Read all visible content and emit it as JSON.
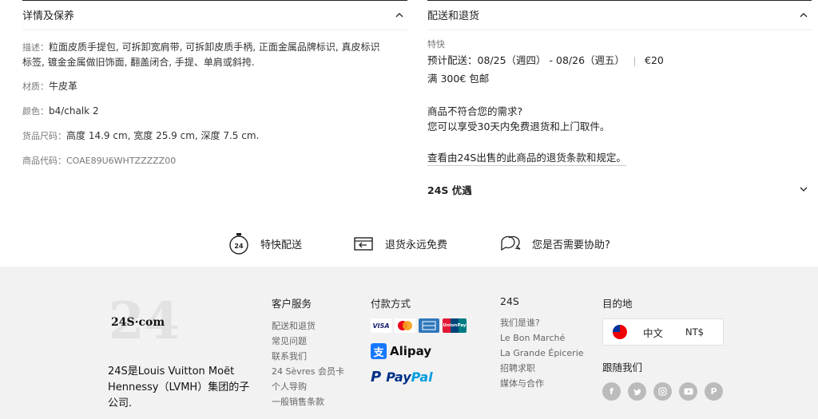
{
  "details": {
    "title": "详情及保养",
    "desc_label": "描述：",
    "desc_line1": "粒面皮质手提包, 可拆卸宽肩带, 可拆卸皮质手柄, 正面金属品牌标识, 真皮标识",
    "desc_line2": "标签, 镀金金属做旧饰面, 翻盖闭合, 手提、单肩或斜挎.",
    "material_label": "材质：",
    "material": "牛皮革",
    "color_label": "颜色：",
    "color": "b4/chalk 2",
    "size_label": "货品尺码：",
    "size": "高度 14.9 cm, 宽度 25.9 cm, 深度 7.5 cm.",
    "code_label": "商品代码：",
    "code": "COAE89U6WHTZZZZZ00"
  },
  "shipping": {
    "title": "配送和退货",
    "express_label": "特快",
    "est_label": "预计配送：",
    "est_dates": "08/25（週四） - 08/26（週五）",
    "price": "€20",
    "free_threshold": "满 300€ 包邮",
    "return_q": "商品不符合您的需求?",
    "return_info": "您可以享受30天内免费退货和上门取件。",
    "return_link": "查看由24S出售的此商品的退货条款和规定。",
    "perks_title": "24S 优遇"
  },
  "features": [
    {
      "label": "特快配送",
      "icon": "stopwatch-24-icon"
    },
    {
      "label": "退货永远免费",
      "icon": "return-box-icon"
    },
    {
      "label": "您是否需要协助?",
      "icon": "chat-bubbles-icon"
    }
  ],
  "footer": {
    "logo_bg": "24",
    "logo_text": "24S·com",
    "group_text": "24S是Louis Vuitton Moët Hennessy（LVMH）集团的子公司.",
    "service": {
      "title": "客户服务",
      "items": [
        "配送和退货",
        "常见问题",
        "联系我们",
        "24 Sèvres 会员卡",
        "个人导购",
        "一般销售条款"
      ]
    },
    "payment": {
      "title": "付款方式",
      "cards": [
        "VISA",
        "mastercard",
        "amex",
        "UnionPay"
      ],
      "alipay": "Alipay",
      "paypal_a": "Pay",
      "paypal_b": "Pal"
    },
    "brand": {
      "title": "24S",
      "items": [
        "我们是谁?",
        "Le Bon Marché",
        "La Grande Épicerie",
        "招聘求职",
        "媒体与合作"
      ]
    },
    "destination": {
      "title": "目的地",
      "language": "中文",
      "currency": "NT$"
    },
    "social": {
      "title": "跟随我们",
      "icons": [
        "facebook-icon",
        "twitter-icon",
        "instagram-icon",
        "youtube-icon",
        "pinterest-icon"
      ]
    }
  }
}
